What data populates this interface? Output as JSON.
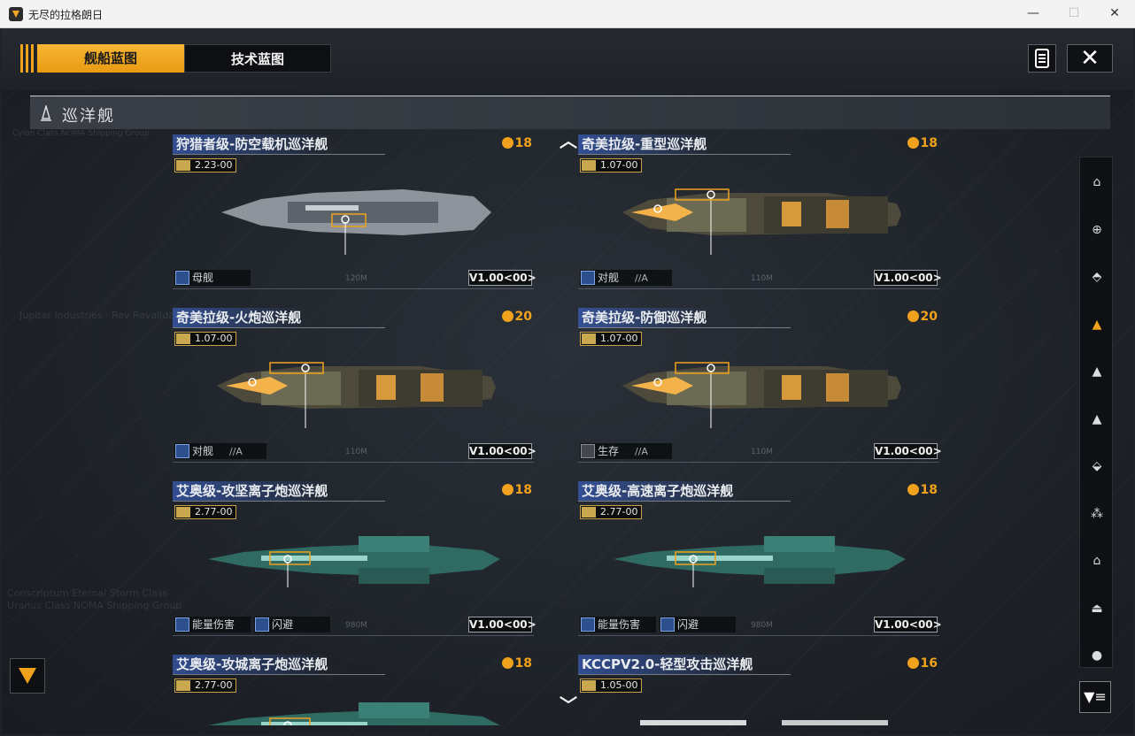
{
  "window": {
    "title": "无尽的拉格朗日",
    "min": "—",
    "max": "☐",
    "close": "✕"
  },
  "tabs": {
    "ship": "舰船蓝图",
    "tech": "技术蓝图"
  },
  "close_label": "✕",
  "section": {
    "title": "巡洋舰",
    "deco": "Cylon Class NOMA Shipping Group"
  },
  "scroll": {
    "up": "︿",
    "down": "﹀"
  },
  "filter_label": "▼≡",
  "background": {
    "text1a": "Conscriptum Eternal Storm Class",
    "text1b": "Uranus Class NOMA Shipping Group",
    "text2": "Jupiter Industries · Rev Revalidative"
  },
  "cards": [
    {
      "title": "狩猎者级-防空载机巡洋舰",
      "cost": "18",
      "version": "2.23-00",
      "tags": [
        {
          "label": "母舰",
          "sub": ""
        }
      ],
      "vbadge": "V1.00<00>",
      "scale": "120M"
    },
    {
      "title": "奇美拉级-重型巡洋舰",
      "cost": "18",
      "version": "1.07-00",
      "tags": [
        {
          "label": "对舰",
          "sub": "//A"
        }
      ],
      "vbadge": "V1.00<00>",
      "scale": "110M"
    },
    {
      "title": "奇美拉级-火炮巡洋舰",
      "cost": "20",
      "version": "1.07-00",
      "tags": [
        {
          "label": "对舰",
          "sub": "//A"
        }
      ],
      "vbadge": "V1.00<00>",
      "scale": "110M"
    },
    {
      "title": "奇美拉级-防御巡洋舰",
      "cost": "20",
      "version": "1.07-00",
      "tags": [
        {
          "label": "生存",
          "sub": "//A"
        }
      ],
      "vbadge": "V1.00<00>",
      "scale": "110M"
    },
    {
      "title": "艾奥级-攻坚离子炮巡洋舰",
      "cost": "18",
      "version": "2.77-00",
      "tags": [
        {
          "label": "能量伤害",
          "sub": ""
        },
        {
          "label": "闪避",
          "sub": ""
        }
      ],
      "vbadge": "V1.00<00>",
      "scale": "980M"
    },
    {
      "title": "艾奥级-高速离子炮巡洋舰",
      "cost": "18",
      "version": "2.77-00",
      "tags": [
        {
          "label": "能量伤害",
          "sub": ""
        },
        {
          "label": "闪避",
          "sub": ""
        }
      ],
      "vbadge": "V1.00<00>",
      "scale": "980M"
    },
    {
      "title": "艾奥级-攻城离子炮巡洋舰",
      "cost": "18",
      "version": "2.77-00",
      "tags": [],
      "vbadge": "",
      "scale": ""
    },
    {
      "title": "KCCPV2.0-轻型攻击巡洋舰",
      "cost": "16",
      "version": "1.05-00",
      "tags": [],
      "vbadge": "",
      "scale": ""
    }
  ],
  "rail_icons": [
    "carrier-icon",
    "battleship-icon",
    "battlecruiser-icon",
    "cruiser-icon",
    "destroyer-icon",
    "frigate-icon",
    "corvette-icon",
    "fighter-icon",
    "aux-icon",
    "station-icon",
    "misc-icon"
  ],
  "colors": {
    "accent": "#f0a21c",
    "tag_blue": "#2e4f8e"
  }
}
